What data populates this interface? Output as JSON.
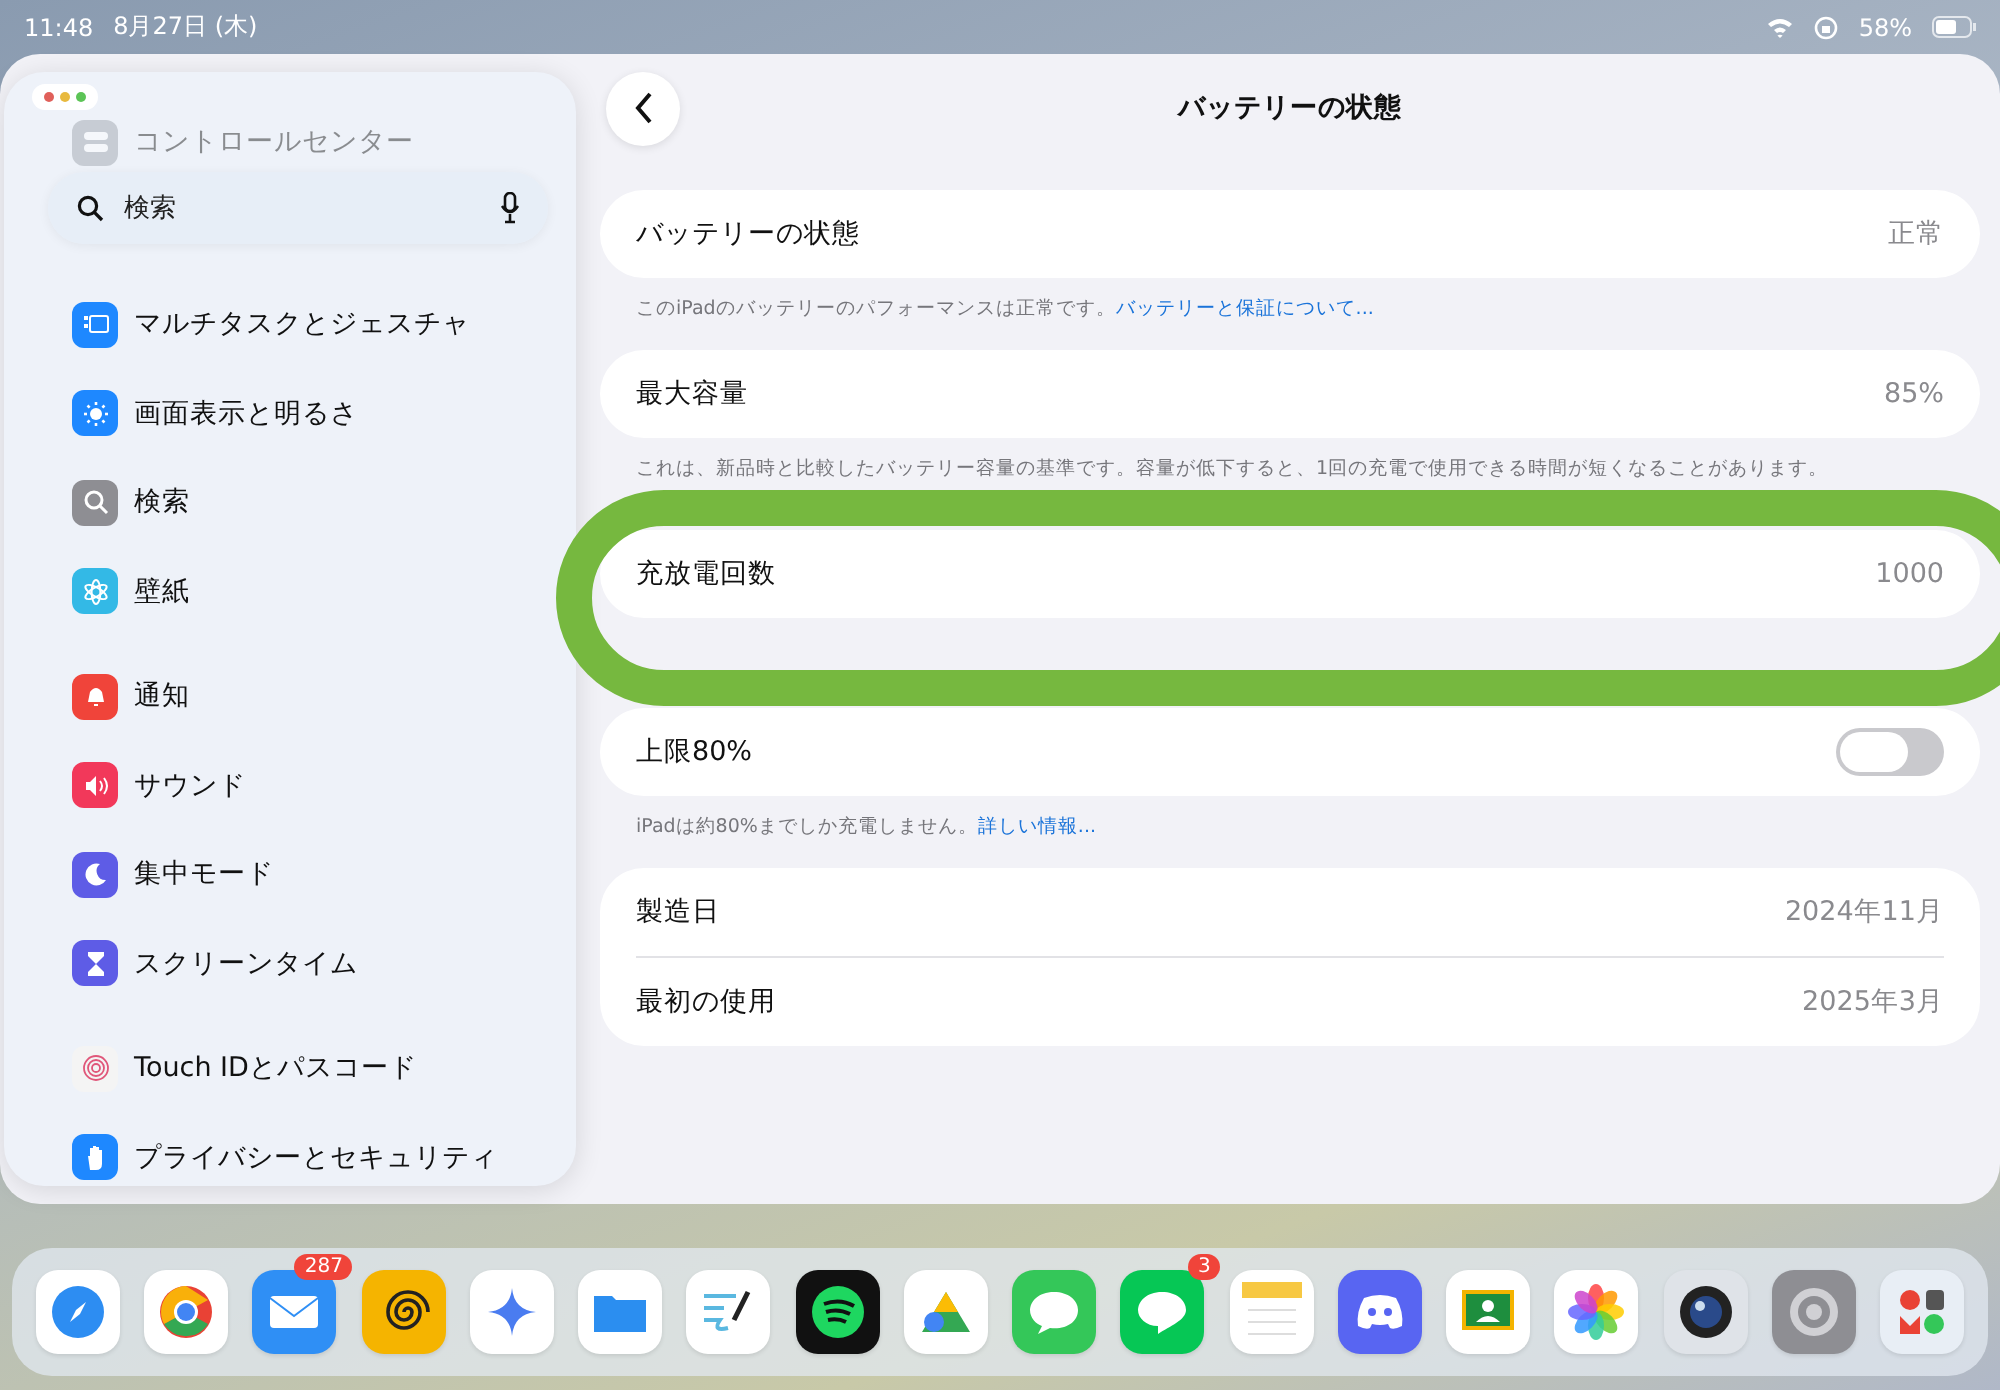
{
  "status_bar": {
    "time": "11:48",
    "date": "8月27日 (木)",
    "battery": "58%"
  },
  "sidebar": {
    "search": {
      "placeholder": "検索"
    },
    "groups": [
      {
        "items": [
          {
            "label": "コントロールセンター",
            "dimmed": true
          },
          {
            "label": "マルチタスクとジェスチャ",
            "dimmed": false
          },
          {
            "label": "画面表示と明るさ",
            "dimmed": false
          },
          {
            "label": "検索",
            "dimmed": false
          },
          {
            "label": "壁紙",
            "dimmed": false
          }
        ]
      },
      {
        "items": [
          {
            "label": "通知",
            "dimmed": false
          },
          {
            "label": "サウンド",
            "dimmed": false
          },
          {
            "label": "集中モード",
            "dimmed": false
          },
          {
            "label": "スクリーンタイム",
            "dimmed": false
          }
        ]
      },
      {
        "items": [
          {
            "label": "Touch IDとパスコード",
            "dimmed": false
          },
          {
            "label": "プライバシーとセキュリティ",
            "dimmed": false
          }
        ]
      }
    ]
  },
  "detail": {
    "title": "バッテリーの状態",
    "groups": [
      {
        "rows": [
          {
            "kind": "value",
            "label": "バッテリーの状態",
            "value": "正常"
          }
        ],
        "footer": {
          "text": "このiPadのバッテリーのパフォーマンスは正常です。",
          "link": "バッテリーと保証について..."
        },
        "highlighted": false
      },
      {
        "rows": [
          {
            "kind": "value",
            "label": "最大容量",
            "value": "85%"
          }
        ],
        "footer": {
          "text": "これは、新品時と比較したバッテリー容量の基準です。容量が低下すると、1回の充電で使用できる時間が短くなることがあります。"
        },
        "highlighted": false
      },
      {
        "rows": [
          {
            "kind": "value",
            "label": "充放電回数",
            "value": "1000"
          }
        ],
        "highlighted": true
      },
      {
        "rows": [
          {
            "kind": "toggle",
            "label": "上限80%",
            "on": false
          }
        ],
        "footer": {
          "text": "iPadは約80%までしか充電しません。",
          "link": "詳しい情報..."
        },
        "highlighted": false
      },
      {
        "rows": [
          {
            "kind": "value",
            "label": "製造日",
            "value": "2024年11月"
          },
          {
            "kind": "value",
            "label": "最初の使用",
            "value": "2025年3月"
          }
        ],
        "highlighted": false
      }
    ]
  },
  "dock": {
    "apps": [
      {
        "kind": "compass"
      },
      {
        "kind": "browser"
      },
      {
        "kind": "mail",
        "badge": "287"
      },
      {
        "kind": "spiral"
      },
      {
        "kind": "sparkle"
      },
      {
        "kind": "files"
      },
      {
        "kind": "pen"
      },
      {
        "kind": "music"
      },
      {
        "kind": "drive"
      },
      {
        "kind": "messages"
      },
      {
        "kind": "messenger",
        "badge": "3"
      },
      {
        "kind": "notes"
      },
      {
        "kind": "chat"
      },
      {
        "kind": "classroom"
      },
      {
        "kind": "photos"
      },
      {
        "kind": "camera"
      },
      {
        "kind": "settings"
      },
      {
        "kind": "folder"
      }
    ]
  }
}
